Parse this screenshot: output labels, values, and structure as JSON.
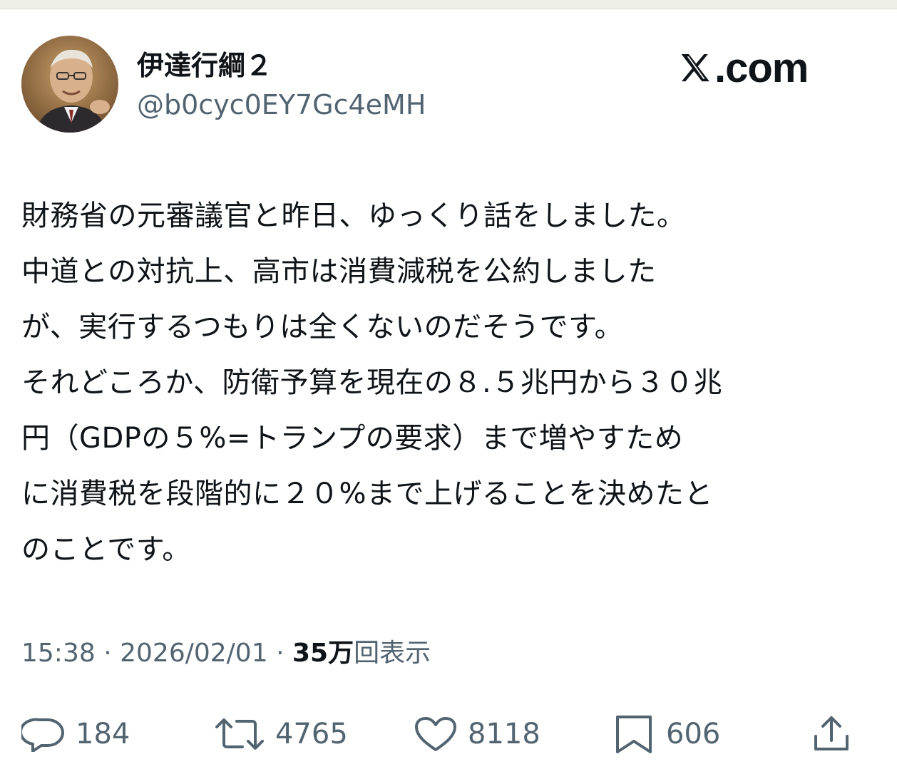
{
  "post": {
    "display_name": "伊達行綱２",
    "handle": "@b0cyc0EY7Gc4eMH",
    "brand": ".com",
    "body_lines": [
      "財務省の元審議官と昨日、ゆっくり話をしました。",
      "中道との対抗上、高市は消費減税を公約しました",
      "が、実行するつもりは全くないのだそうです。",
      "それどころか、防衛予算を現在の８.５兆円から３０兆",
      "円（GDPの５%=トランプの要求）まで増やすため",
      "に消費税を段階的に２０%まで上げることを決めたと",
      "のことです。"
    ],
    "time": "15:38",
    "separator": "·",
    "date": "2026/02/01",
    "views_count": "35万",
    "views_label": "回表示"
  },
  "actions": {
    "reply": {
      "icon": "reply-icon",
      "count": "184"
    },
    "repost": {
      "icon": "repost-icon",
      "count": "4765"
    },
    "like": {
      "icon": "heart-icon",
      "count": "8118"
    },
    "bookmark": {
      "icon": "bookmark-icon",
      "count": "606"
    },
    "share": {
      "icon": "share-icon"
    }
  },
  "colors": {
    "text": "#0f1419",
    "secondary": "#536471",
    "background": "#ffffff"
  }
}
